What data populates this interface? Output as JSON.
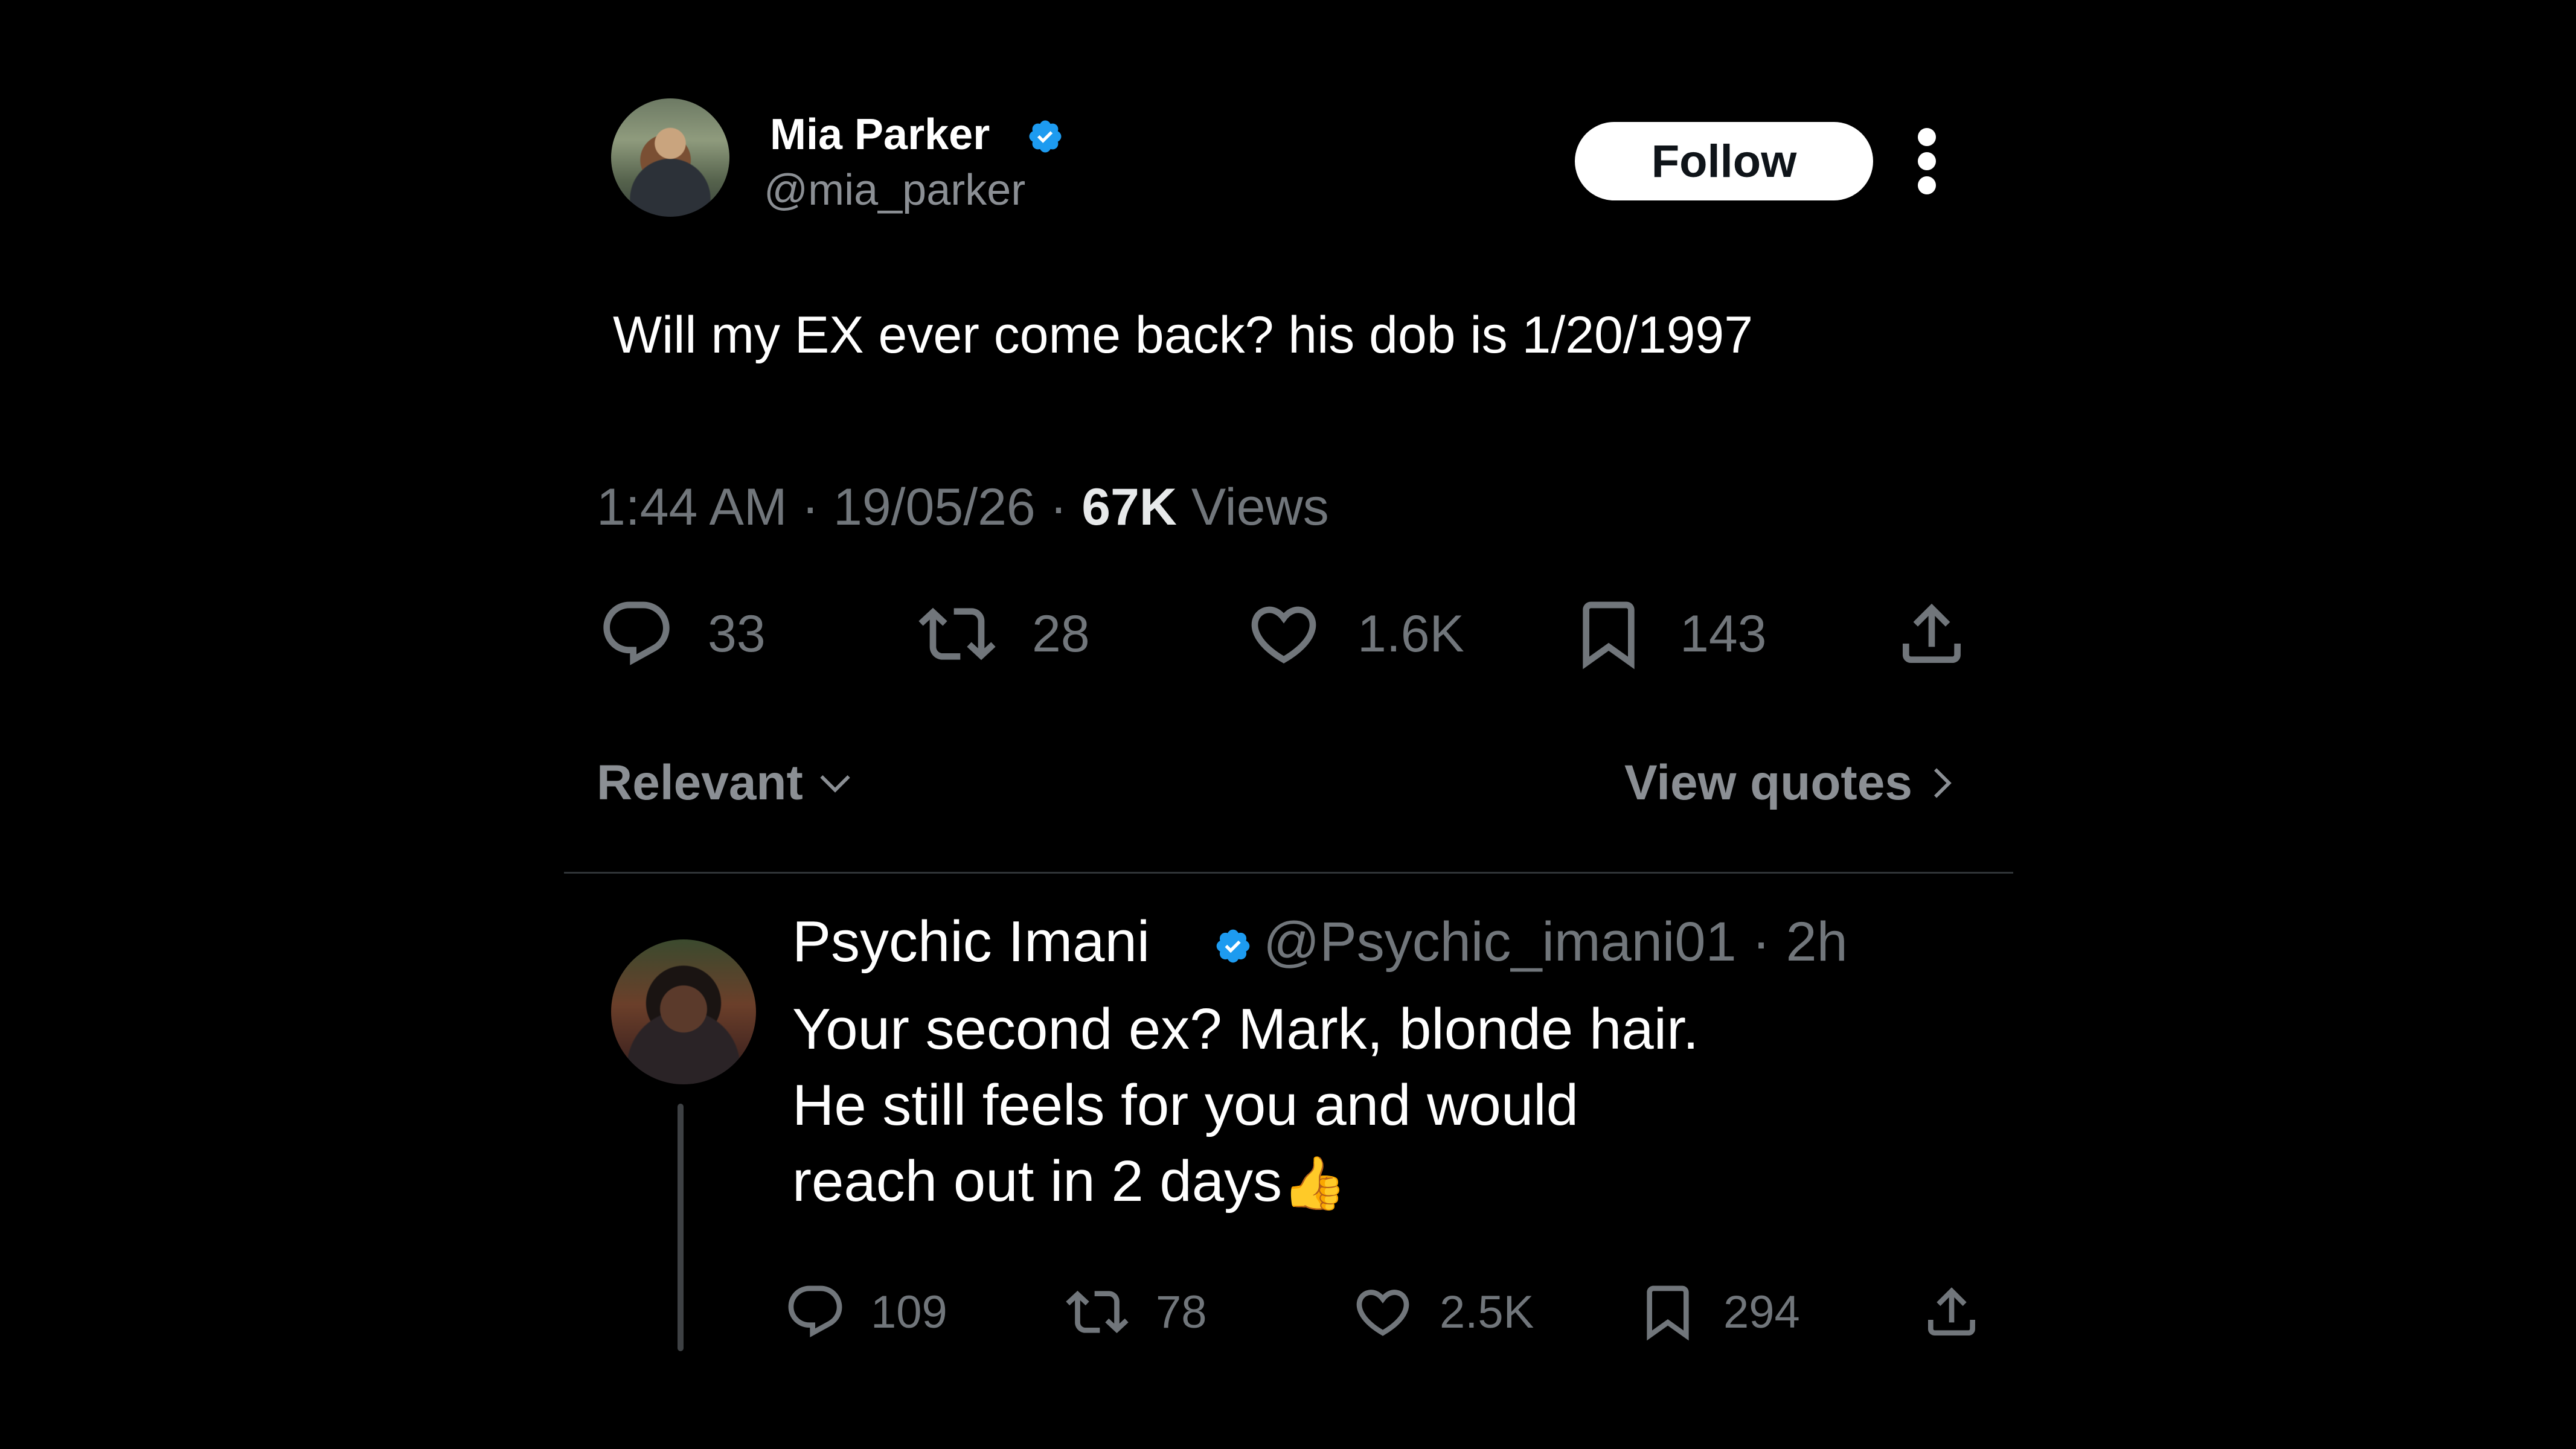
{
  "tweet": {
    "author": {
      "display_name": "Mia Parker",
      "handle": "@mia_parker",
      "verified": true
    },
    "follow_label": "Follow",
    "text": "Will my EX ever come back? his dob is 1/20/1997",
    "time": "1:44 AM",
    "date": "19/05/26",
    "views_count": "67K",
    "views_label": "Views",
    "separator": "·",
    "actions": {
      "replies": "33",
      "reposts": "28",
      "likes": "1.6K",
      "bookmarks": "143"
    }
  },
  "sort_bar": {
    "sort_label": "Relevant",
    "quotes_label": "View quotes"
  },
  "reply": {
    "author": {
      "display_name": "Psychic Imani",
      "handle": "@Psychic_imani01",
      "verified": true
    },
    "age": "· 2h",
    "text_lines": [
      "Your second ex? Mark, blonde hair.",
      "He still feels for you and would",
      "reach out in 2 days"
    ],
    "emoji": "👍",
    "actions": {
      "replies": "109",
      "reposts": "78",
      "likes": "2.5K",
      "bookmarks": "294"
    }
  },
  "icons": {
    "verified": "verified-badge-icon",
    "reply": "reply-icon",
    "repost": "repost-icon",
    "like": "heart-icon",
    "bookmark": "bookmark-icon",
    "share": "share-icon",
    "more": "more-vertical-icon"
  },
  "colors": {
    "background": "#000000",
    "text_primary": "#ffffff",
    "text_secondary": "#71767b",
    "verified_blue": "#1d9bf0",
    "follow_bg": "#ffffff"
  }
}
